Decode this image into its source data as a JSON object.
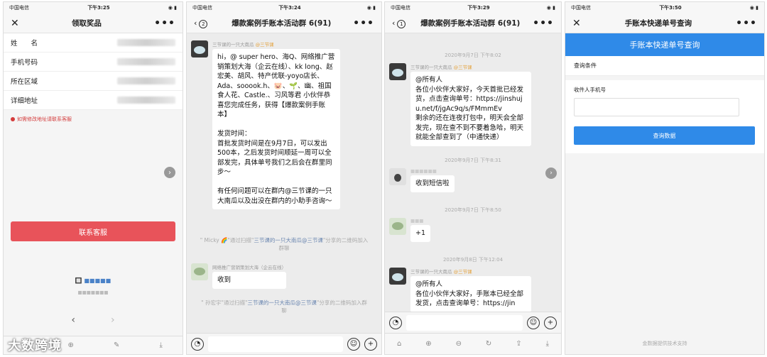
{
  "p1": {
    "status": {
      "carrier": "中国电信",
      "time": "下午3:25"
    },
    "title": "领取奖品",
    "fields": [
      {
        "label": "姓　　名"
      },
      {
        "label": "手机号码"
      },
      {
        "label": "所在区域"
      },
      {
        "label": "详细地址"
      }
    ],
    "warning": "如需修改地址请联系客服",
    "contact_button": "联系客服",
    "brand": "🔲 ■■■■■",
    "brand_sub": "■■■■■■■",
    "nav_back": "‹",
    "nav_forward": "›"
  },
  "p2": {
    "status": {
      "carrier": "中国电信",
      "time": "下午3:24"
    },
    "back_count": "2",
    "title": "爆款案例手账本活动群 6(91)",
    "msg1": {
      "sender": "三节课的一只大南瓜",
      "tag": "@三节课",
      "text": "hi，@ super hero、海Q、网络推广营销策划大海（企云在线）、kk long、赵宏美、胡风、特产优联-yoyo店长、Ada、sooook.h、🐷、🌱、幽、祖国食人花、Castle.、习风等君 小伙伴恭喜您完成任务，获得【爆款案例手账本】\n\n发货时间：\n首批发货时间是在9月7日，可以发出500本，之后发货时间顺延一周可以全部发完，具体单号我们之后会在群里同步～\n\n有任何问题可以在群内@三节课的一只大南瓜以及出没在群内的小助手咨询～"
    },
    "sys1": {
      "pre": "\" Micky 🌈\"通过扫描\"",
      "link": "三节课的一只大南瓜@三节课",
      "post": "\"分享的二维码加入群聊"
    },
    "msg2": {
      "sender": "网络推广营销策划大海（企云在线）",
      "text": "收到"
    },
    "sys2": {
      "pre": "\" 孙宏宇\"通过扫描\"",
      "link": "三节课的一只大南瓜@三节课",
      "post": "\"分享的二维码加入群聊"
    }
  },
  "p3": {
    "status": {
      "carrier": "中国电信",
      "time": "下午3:29"
    },
    "back_count": "1",
    "title": "爆款案例手账本活动群 6(91)",
    "time1": "2020年9月7日 下午8:02",
    "msg1": {
      "sender": "三节课的一只大南瓜",
      "tag": "@三节课",
      "text": "@所有人\n各位小伙伴大家好，今天首批已经发货，点击查询单号：https://jinshuju.net/f/jgAc9q/s/FMmmEv\n剩余的还在连夜打包中，明天会全部发完，现在查不到不要着急哈，明天就能全部查到了（中通快递）"
    },
    "time2": "2020年9月7日 下午8:31",
    "msg2": {
      "text": "收到短信啦"
    },
    "time3": "2020年9月7日 下午8:50",
    "msg3": {
      "text": "+1"
    },
    "time4": "2020年9月8日 下午12:04",
    "msg4": {
      "sender": "三节课的一只大南瓜",
      "tag": "@三节课",
      "text": "@所有人\n各位小伙伴大家好，手账本已经全部发货，点击查询单号：https://jin"
    }
  },
  "p4": {
    "status": {
      "carrier": "中国电信",
      "time": "下午3:50"
    },
    "title": "手账本快递单号查询",
    "header": "手账本快递单号查询",
    "section": "查询条件",
    "phone_label": "收件人手机号",
    "query_button": "查询数据",
    "footer": "金数据提供技术支持"
  },
  "watermark": "大数跨境"
}
